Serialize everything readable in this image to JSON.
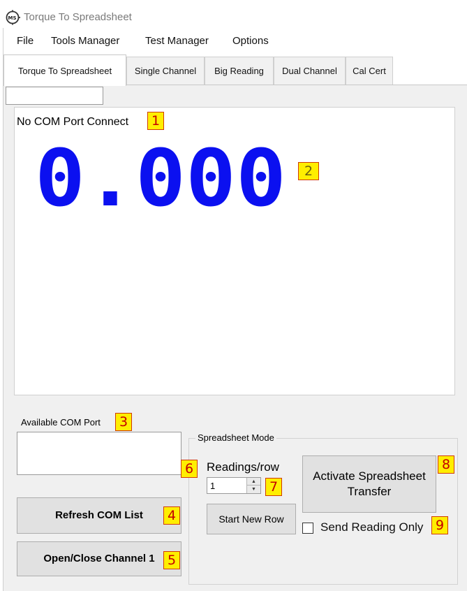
{
  "window": {
    "title": "Torque To Spreadsheet"
  },
  "menu": {
    "items": [
      {
        "label": "File"
      },
      {
        "label": "Tools Manager"
      },
      {
        "label": "Test Manager"
      },
      {
        "label": "Options"
      }
    ]
  },
  "tabs": [
    {
      "label": "Torque To Spreadsheet",
      "active": true
    },
    {
      "label": "Single Channel",
      "active": false
    },
    {
      "label": "Big Reading",
      "active": false
    },
    {
      "label": "Dual Channel",
      "active": false
    },
    {
      "label": "Cal Cert",
      "active": false
    }
  ],
  "display": {
    "status": "No COM Port Connect",
    "reading": "0.000",
    "reading_color": "#0b10f0"
  },
  "com": {
    "label": "Available COM Port",
    "refresh_button": "Refresh COM List",
    "open_close_button": "Open/Close Channel 1"
  },
  "spreadsheet": {
    "group_title": "Spreadsheet Mode",
    "readings_label": "Readings/row",
    "readings_value": "1",
    "start_new_row_button": "Start New Row",
    "activate_button": "Activate Spreadsheet Transfer",
    "send_reading_only_label": "Send Reading Only",
    "send_reading_only_checked": false
  },
  "annotations": [
    "1",
    "2",
    "3",
    "4",
    "5",
    "6",
    "7",
    "8",
    "9"
  ],
  "colors": {
    "marker_bg": "#ffee00",
    "marker_text": "#c40000",
    "panel_bg": "#f0f0f0"
  }
}
